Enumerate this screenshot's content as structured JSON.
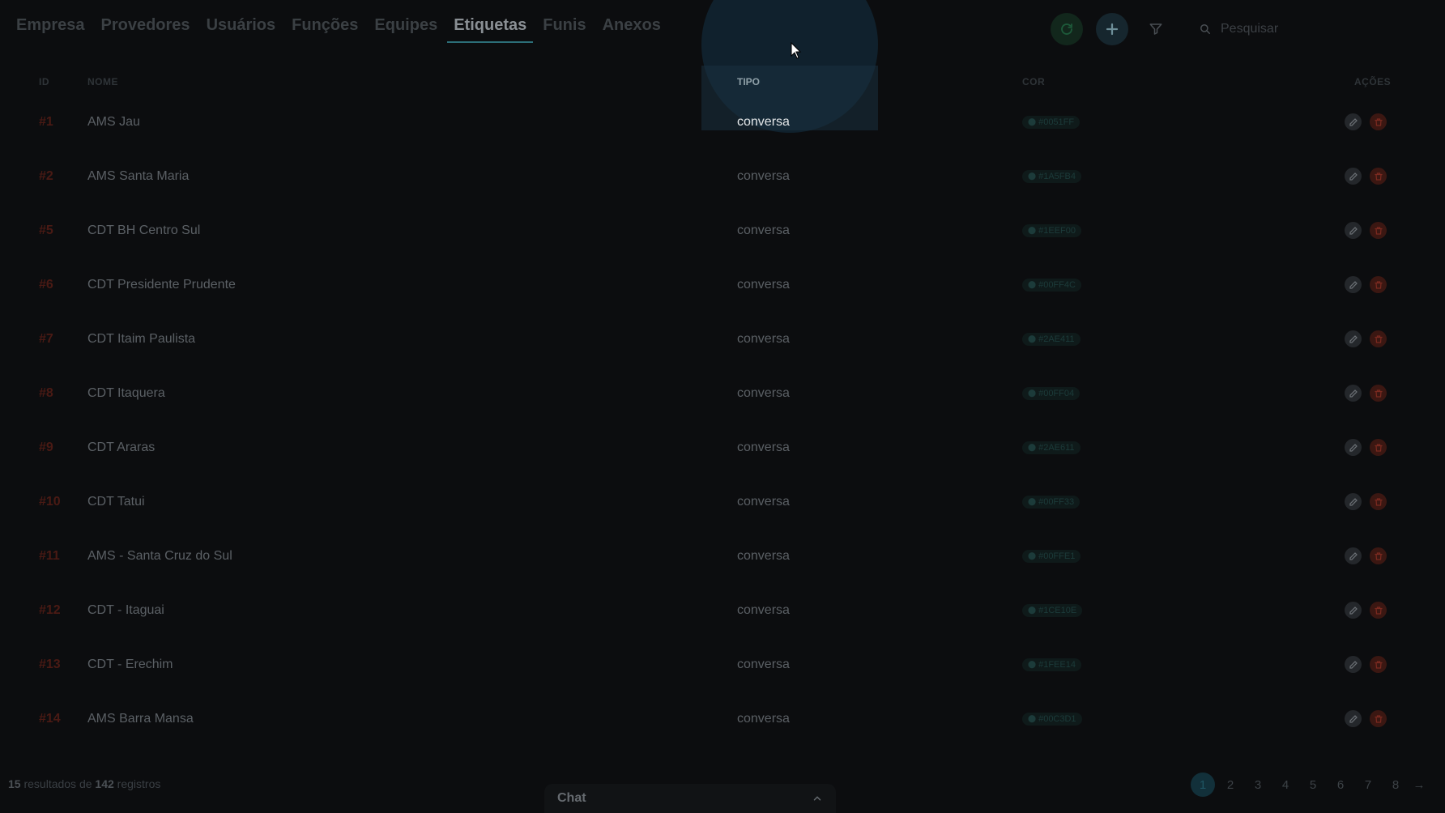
{
  "tabs": [
    {
      "label": "Empresa",
      "active": false
    },
    {
      "label": "Provedores",
      "active": false
    },
    {
      "label": "Usuários",
      "active": false
    },
    {
      "label": "Funções",
      "active": false
    },
    {
      "label": "Equipes",
      "active": false
    },
    {
      "label": "Etiquetas",
      "active": true
    },
    {
      "label": "Funis",
      "active": false
    },
    {
      "label": "Anexos",
      "active": false
    }
  ],
  "toolbar": {
    "refresh_icon": "refresh-icon",
    "add_icon": "plus-icon",
    "filter_icon": "filter-icon",
    "search_placeholder": "Pesquisar"
  },
  "table": {
    "columns": {
      "id": "ID",
      "nome": "NOME",
      "tipo": "TIPO",
      "cor": "COR",
      "acoes": "AÇÕES"
    },
    "rows": [
      {
        "id": "#1",
        "nome": "AMS Jau",
        "tipo": "conversa",
        "cor": "#0051FF"
      },
      {
        "id": "#2",
        "nome": "AMS Santa Maria",
        "tipo": "conversa",
        "cor": "#1A5FB4"
      },
      {
        "id": "#5",
        "nome": "CDT BH Centro Sul",
        "tipo": "conversa",
        "cor": "#1EEF00"
      },
      {
        "id": "#6",
        "nome": "CDT Presidente Prudente",
        "tipo": "conversa",
        "cor": "#00FF4C"
      },
      {
        "id": "#7",
        "nome": "CDT Itaim Paulista",
        "tipo": "conversa",
        "cor": "#2AE411"
      },
      {
        "id": "#8",
        "nome": "CDT Itaquera",
        "tipo": "conversa",
        "cor": "#00FF04"
      },
      {
        "id": "#9",
        "nome": "CDT Araras",
        "tipo": "conversa",
        "cor": "#2AE611"
      },
      {
        "id": "#10",
        "nome": "CDT Tatui",
        "tipo": "conversa",
        "cor": "#00FF33"
      },
      {
        "id": "#11",
        "nome": "AMS - Santa Cruz do Sul",
        "tipo": "conversa",
        "cor": "#00FFE1"
      },
      {
        "id": "#12",
        "nome": "CDT - Itaguai",
        "tipo": "conversa",
        "cor": "#1CE10E"
      },
      {
        "id": "#13",
        "nome": "CDT - Erechim",
        "tipo": "conversa",
        "cor": "#1FEE14"
      },
      {
        "id": "#14",
        "nome": "AMS Barra Mansa",
        "tipo": "conversa",
        "cor": "#00C3D1"
      }
    ]
  },
  "footer": {
    "count": "15",
    "results_text": " resultados de ",
    "total": "142",
    "records_text": " registros"
  },
  "pagination": {
    "pages": [
      "1",
      "2",
      "3",
      "4",
      "5",
      "6",
      "7",
      "8"
    ],
    "current": "1",
    "next": "→"
  },
  "chat": {
    "label": "Chat"
  },
  "colors": {
    "accent": "#2c6e78",
    "danger": "#3b1712",
    "background": "#0c0d0f"
  }
}
